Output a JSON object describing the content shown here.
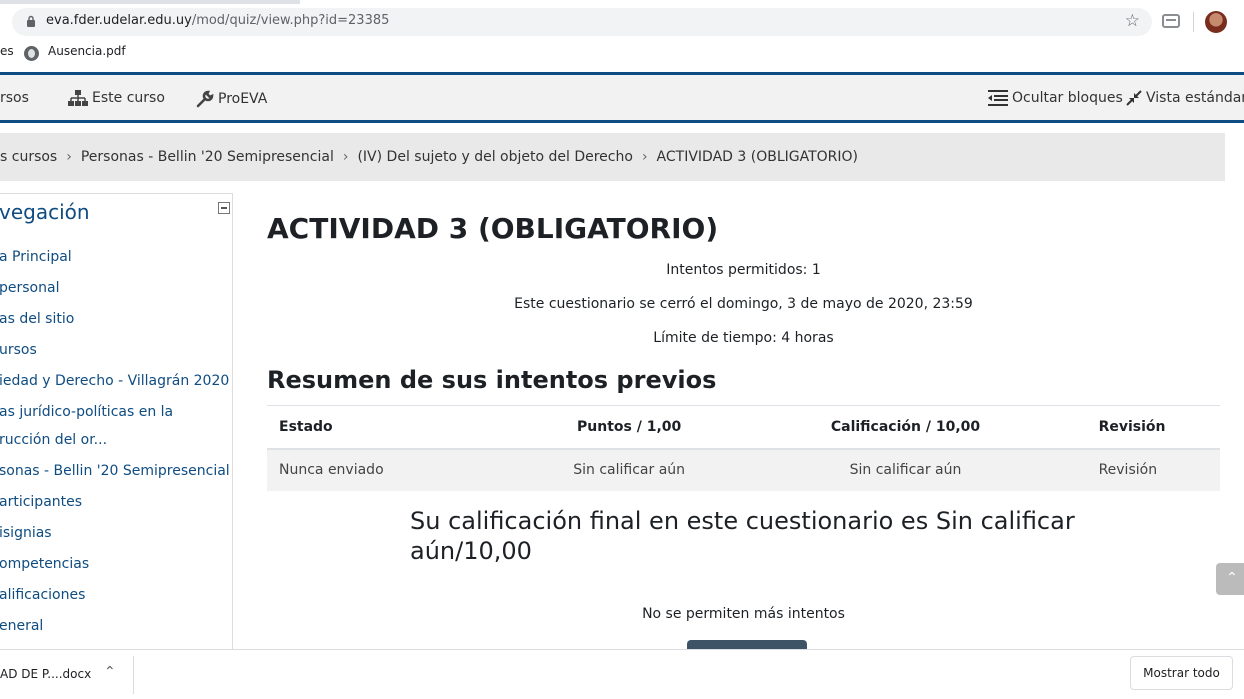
{
  "browser": {
    "url_host": "eva.fder.udelar.edu.uy",
    "url_path": "/mod/quiz/view.php?id=23385",
    "bookmarks": [
      "es",
      "Ausencia.pdf"
    ]
  },
  "navbar": {
    "items": [
      "rsos",
      "Este curso",
      "ProEVA"
    ],
    "right_items": [
      "Ocultar bloques",
      "Vista estándar"
    ]
  },
  "breadcrumb": [
    "s cursos",
    "Personas - Bellin '20 Semipresencial",
    "(IV) Del sujeto y del objeto del Derecho",
    "ACTIVIDAD 3 (OBLIGATORIO)"
  ],
  "sidebar": {
    "title": "vegación",
    "items": [
      "a Principal",
      "personal",
      "as del sitio",
      "ursos",
      "iedad y Derecho - Villagrán 2020",
      "as jurídico-políticas en la",
      "rucción del or...",
      "sonas - Bellin '20 Semipresencial",
      "articipantes",
      "isignias",
      "ompetencias",
      "alificaciones",
      "eneral"
    ]
  },
  "main": {
    "title": "ACTIVIDAD 3 (OBLIGATORIO)",
    "info": [
      "Intentos permitidos: 1",
      "Este cuestionario se cerró el domingo, 3 de mayo de 2020, 23:59",
      "Límite de tiempo: 4 horas"
    ],
    "summary_heading": "Resumen de sus intentos previos",
    "table": {
      "headers": [
        "Estado",
        "Puntos / 1,00",
        "Calificación / 10,00",
        "Revisión"
      ],
      "rows": [
        [
          "Nunca enviado",
          "Sin calificar aún",
          "Sin calificar aún",
          "Revisión"
        ]
      ]
    },
    "final_grade": "Su calificación final en este cuestionario es Sin calificar aún/10,00",
    "no_more": "No se permiten más intentos"
  },
  "downloads": {
    "file": "AD DE P....docx",
    "show_all": "Mostrar todo"
  }
}
